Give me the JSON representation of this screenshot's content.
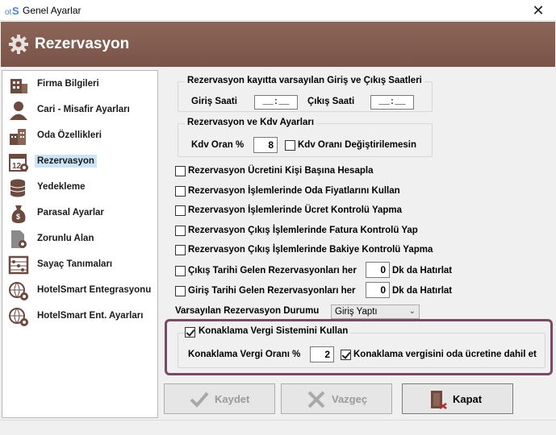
{
  "window": {
    "title": "Genel Ayarlar",
    "close_glyph": "✕"
  },
  "header": {
    "title": "Rezervasyon",
    "icon": "gear-icon"
  },
  "sidebar": {
    "items": [
      {
        "label": "Firma Bilgileri",
        "icon": "building-icon"
      },
      {
        "label": "Cari - Misafir Ayarları",
        "icon": "user-icon"
      },
      {
        "label": "Oda Özellikleri",
        "icon": "hotel-icon"
      },
      {
        "label": "Rezervasyon",
        "icon": "calendar-icon",
        "active": true
      },
      {
        "label": "Yedekleme",
        "icon": "database-icon"
      },
      {
        "label": "Parasal Ayarlar",
        "icon": "money-bag-icon"
      },
      {
        "label": "Zorunlu Alan",
        "icon": "document-gear-icon"
      },
      {
        "label": "Sayaç Tanımaları",
        "icon": "abacus-icon"
      },
      {
        "label": "HotelSmart Entegrasyonu",
        "icon": "globe-gear-icon"
      },
      {
        "label": "HotelSmart Ent. Ayarları",
        "icon": "globe-gear-icon"
      }
    ]
  },
  "checkin_group": {
    "title": "Rezervasyon kayıtta varsayılan Giriş ve Çıkış Saatleri",
    "giris_label": "Giriş Saati",
    "giris_value": "__:__",
    "cikis_label": "Çıkış Saati",
    "cikis_value": "__:__"
  },
  "kdv_group": {
    "title": "Rezervasyon ve  Kdv Ayarları",
    "kdv_label": "Kdv Oran %",
    "kdv_value": "8",
    "kdv_lock_label": "Kdv Oranı Değiştirilemesin",
    "kdv_lock_checked": false
  },
  "options": [
    {
      "label": "Rezervasyon Ücretini Kişi Başına Hesapla",
      "checked": false
    },
    {
      "label": "Rezervasyon İşlemlerinde Oda Fiyatlarını Kullan",
      "checked": false
    },
    {
      "label": "Rezervasyon İşlemlerinde Ücret Kontrolü Yapma",
      "checked": false
    },
    {
      "label": "Rezervasyon Çıkış İşlemlerinde Fatura Kontrolü Yap",
      "checked": false
    },
    {
      "label": "Rezervasyon Çıkış İşlemlerinde Bakiye Kontrolü Yapma",
      "checked": false
    }
  ],
  "reminders": [
    {
      "label": "Çıkış Tarihi Gelen Rezervasyonları her",
      "value": "0",
      "suffix": "Dk da Hatırlat",
      "checked": false
    },
    {
      "label": "Giriş Tarihi Gelen Rezervasyonları her",
      "value": "0",
      "suffix": "Dk da Hatırlat",
      "checked": false
    }
  ],
  "default_status": {
    "label": "Varsayılan Rezervasyon Durumu",
    "value": "Giriş Yaptı"
  },
  "konaklama": {
    "title": "Konaklama Vergi Sistemini Kullan",
    "checked": true,
    "rate_label": "Konaklama Vergi Oranı %",
    "rate_value": "2",
    "include_label": "Konaklama vergisini oda ücretine dahil et",
    "include_checked": true,
    "highlight_color": "#7a4963"
  },
  "buttons": {
    "save": "Kaydet",
    "cancel": "Vazgeç",
    "close": "Kapat"
  },
  "colors": {
    "header_bg": "#7a5448",
    "active_item": "#cce4f7"
  }
}
